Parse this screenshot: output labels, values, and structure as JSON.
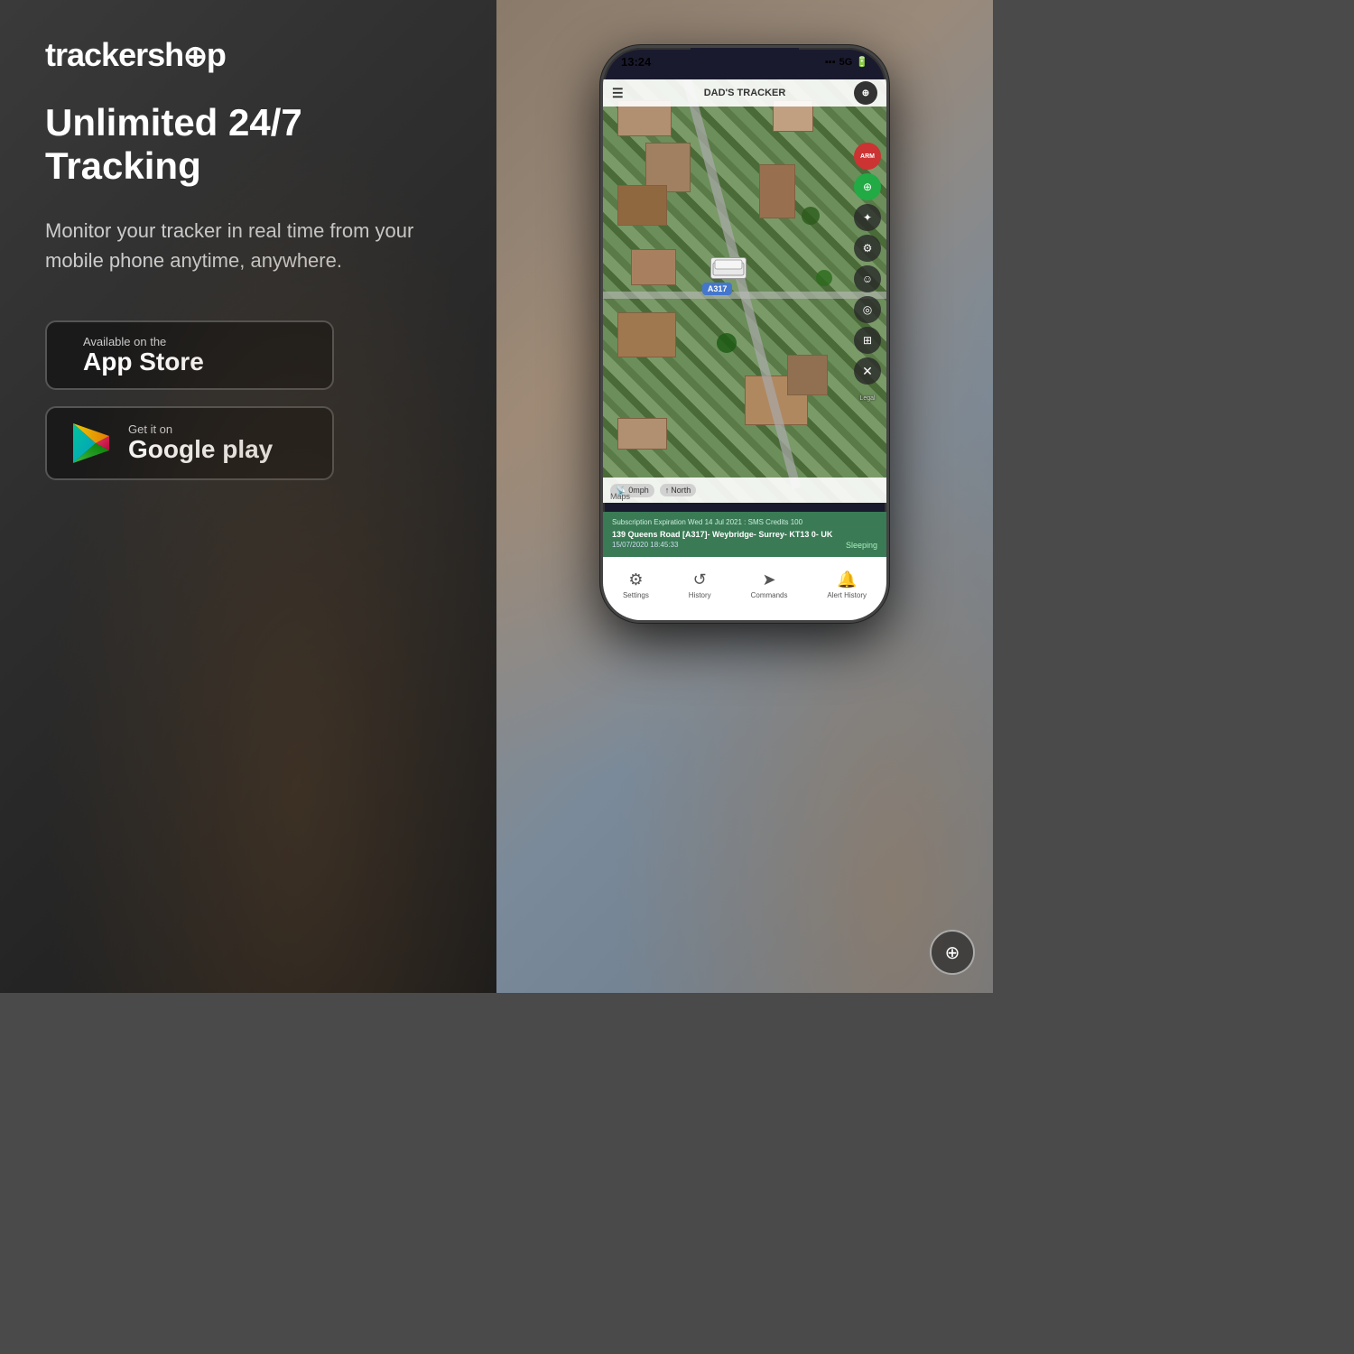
{
  "brand": {
    "name_part1": "trackersh",
    "name_part2": "p",
    "logo_symbol": "⊕"
  },
  "headline": "Unlimited 24/7 Tracking",
  "subtext": "Monitor your tracker in real time from your mobile phone anytime, anywhere.",
  "app_store": {
    "small_text": "Available on the",
    "big_text": "App Store",
    "icon": ""
  },
  "google_play": {
    "small_text": "Get it on",
    "big_text": "Google play"
  },
  "phone": {
    "status_time": "13:24",
    "status_signal": "5G",
    "tracker_name": "DAD'S TRACKER",
    "speed": "0mph",
    "direction": "North",
    "road_sign": "A317",
    "maps_label": "Maps",
    "subscription_text": "Subscription Expiration Wed 14 Jul 2021 : SMS Credits 100",
    "address_text": "139 Queens Road [A317]- Weybridge- Surrey- KT13 0- UK",
    "datetime_text": "15/07/2020 18:45:33",
    "status_sleeping": "Sleeping",
    "nav_settings": "Settings",
    "nav_history": "History",
    "nav_commands": "Commands",
    "nav_alert": "Alert History",
    "arm_label": "ARM",
    "legal_label": "Legal"
  }
}
